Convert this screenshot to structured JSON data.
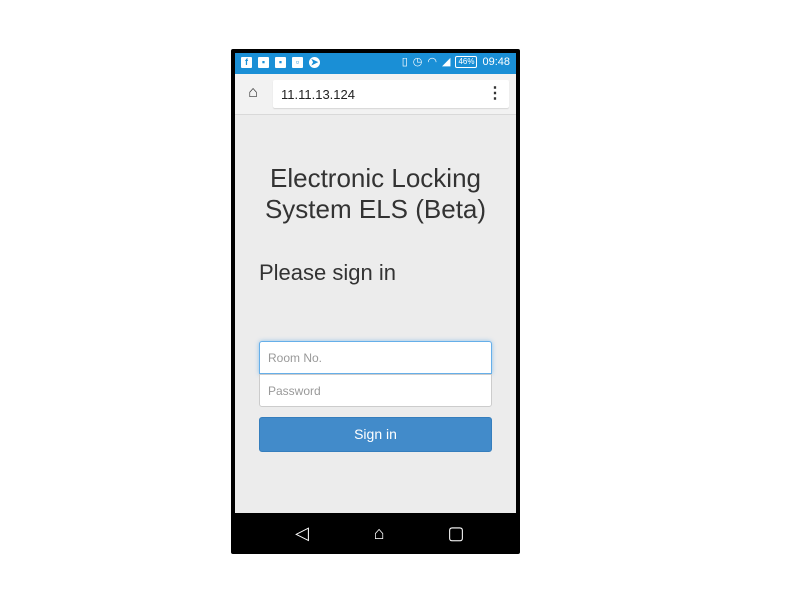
{
  "statusbar": {
    "left_icons": [
      "facebook-icon",
      "image-icon",
      "photos-icon",
      "clipboard-icon",
      "telegram-icon"
    ],
    "right_icons": [
      "vibrate-icon",
      "alarm-icon",
      "wifi-icon",
      "signal-icon"
    ],
    "battery": "46%",
    "time": "09:48"
  },
  "browser": {
    "url": "11.11.13.124",
    "home_icon": "home-icon",
    "menu_icon": "menu-icon"
  },
  "page": {
    "title_line1": "Electronic Locking",
    "title_line2": "System ELS (Beta)",
    "heading": "Please sign in",
    "room_placeholder": "Room No.",
    "password_placeholder": "Password",
    "signin_label": "Sign in"
  },
  "navbar": {
    "back_icon": "back-icon",
    "home_icon": "home-icon",
    "recents_icon": "recents-icon"
  },
  "colors": {
    "statusbar": "#1a8fd6",
    "button": "#428bca",
    "background": "#ececec"
  }
}
